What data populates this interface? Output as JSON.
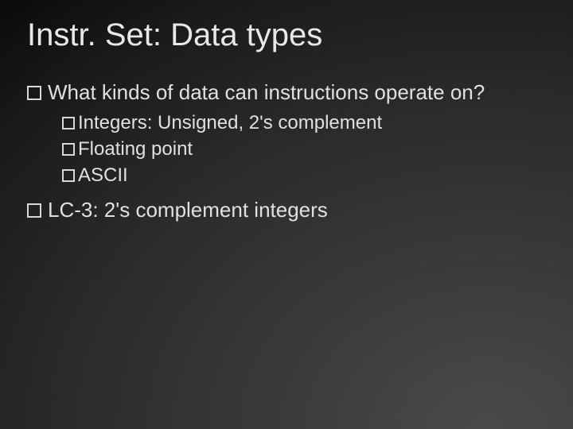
{
  "title": "Instr. Set: Data types",
  "bullets": [
    {
      "level": 1,
      "text": "What kinds of data can instructions operate on?"
    },
    {
      "level": 2,
      "text": "Integers: Unsigned, 2's complement"
    },
    {
      "level": 2,
      "text": "Floating point"
    },
    {
      "level": 2,
      "text": "ASCII"
    },
    {
      "level": 1,
      "text": "LC-3: 2's complement integers"
    }
  ]
}
